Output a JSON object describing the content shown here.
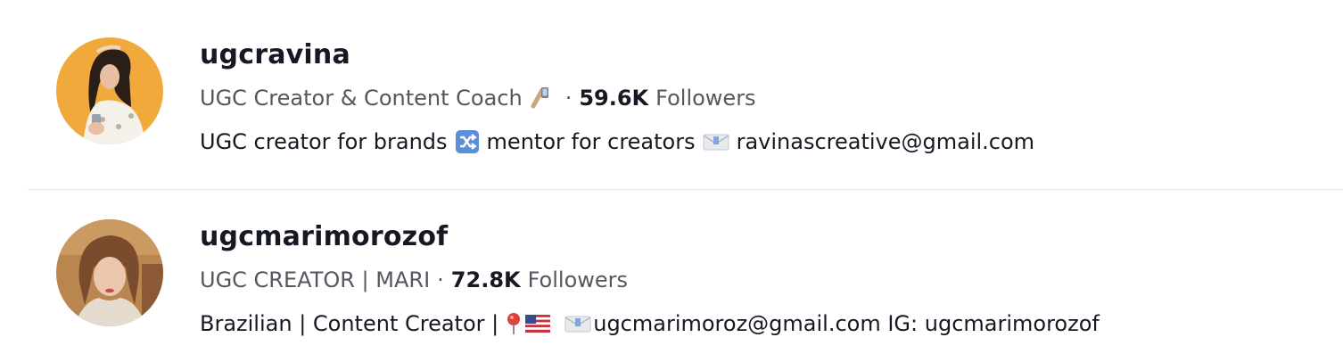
{
  "accounts": [
    {
      "username": "ugcravina",
      "nickname": "UGC Creator & Content Coach",
      "separator": "·",
      "followers_count": "59.6K",
      "followers_label": "Followers",
      "bio_part1": "UGC creator for brands",
      "bio_part2": "mentor for creators",
      "bio_part3": "ravinascreative@gmail.com"
    },
    {
      "username": "ugcmarimorozof",
      "nickname": "UGC CREATOR | MARI",
      "separator": "·",
      "followers_count": "72.8K",
      "followers_label": "Followers",
      "bio_part1": "Brazilian | Content Creator |",
      "bio_part2": "ugcmarimoroz@gmail.com IG: ugcmarimorozof"
    }
  ],
  "icons": {
    "phone": "mobile-phone-icon",
    "shuffle": "shuffle-icon",
    "email": "envelope-icon",
    "pin": "pin-icon",
    "flag": "us-flag-icon"
  },
  "colors": {
    "text_primary": "#161823",
    "text_secondary": "#56575e",
    "divider": "#e3e3e4",
    "avatar1_bg": "#f2a93b",
    "shuffle_blue": "#5b8fd9"
  }
}
